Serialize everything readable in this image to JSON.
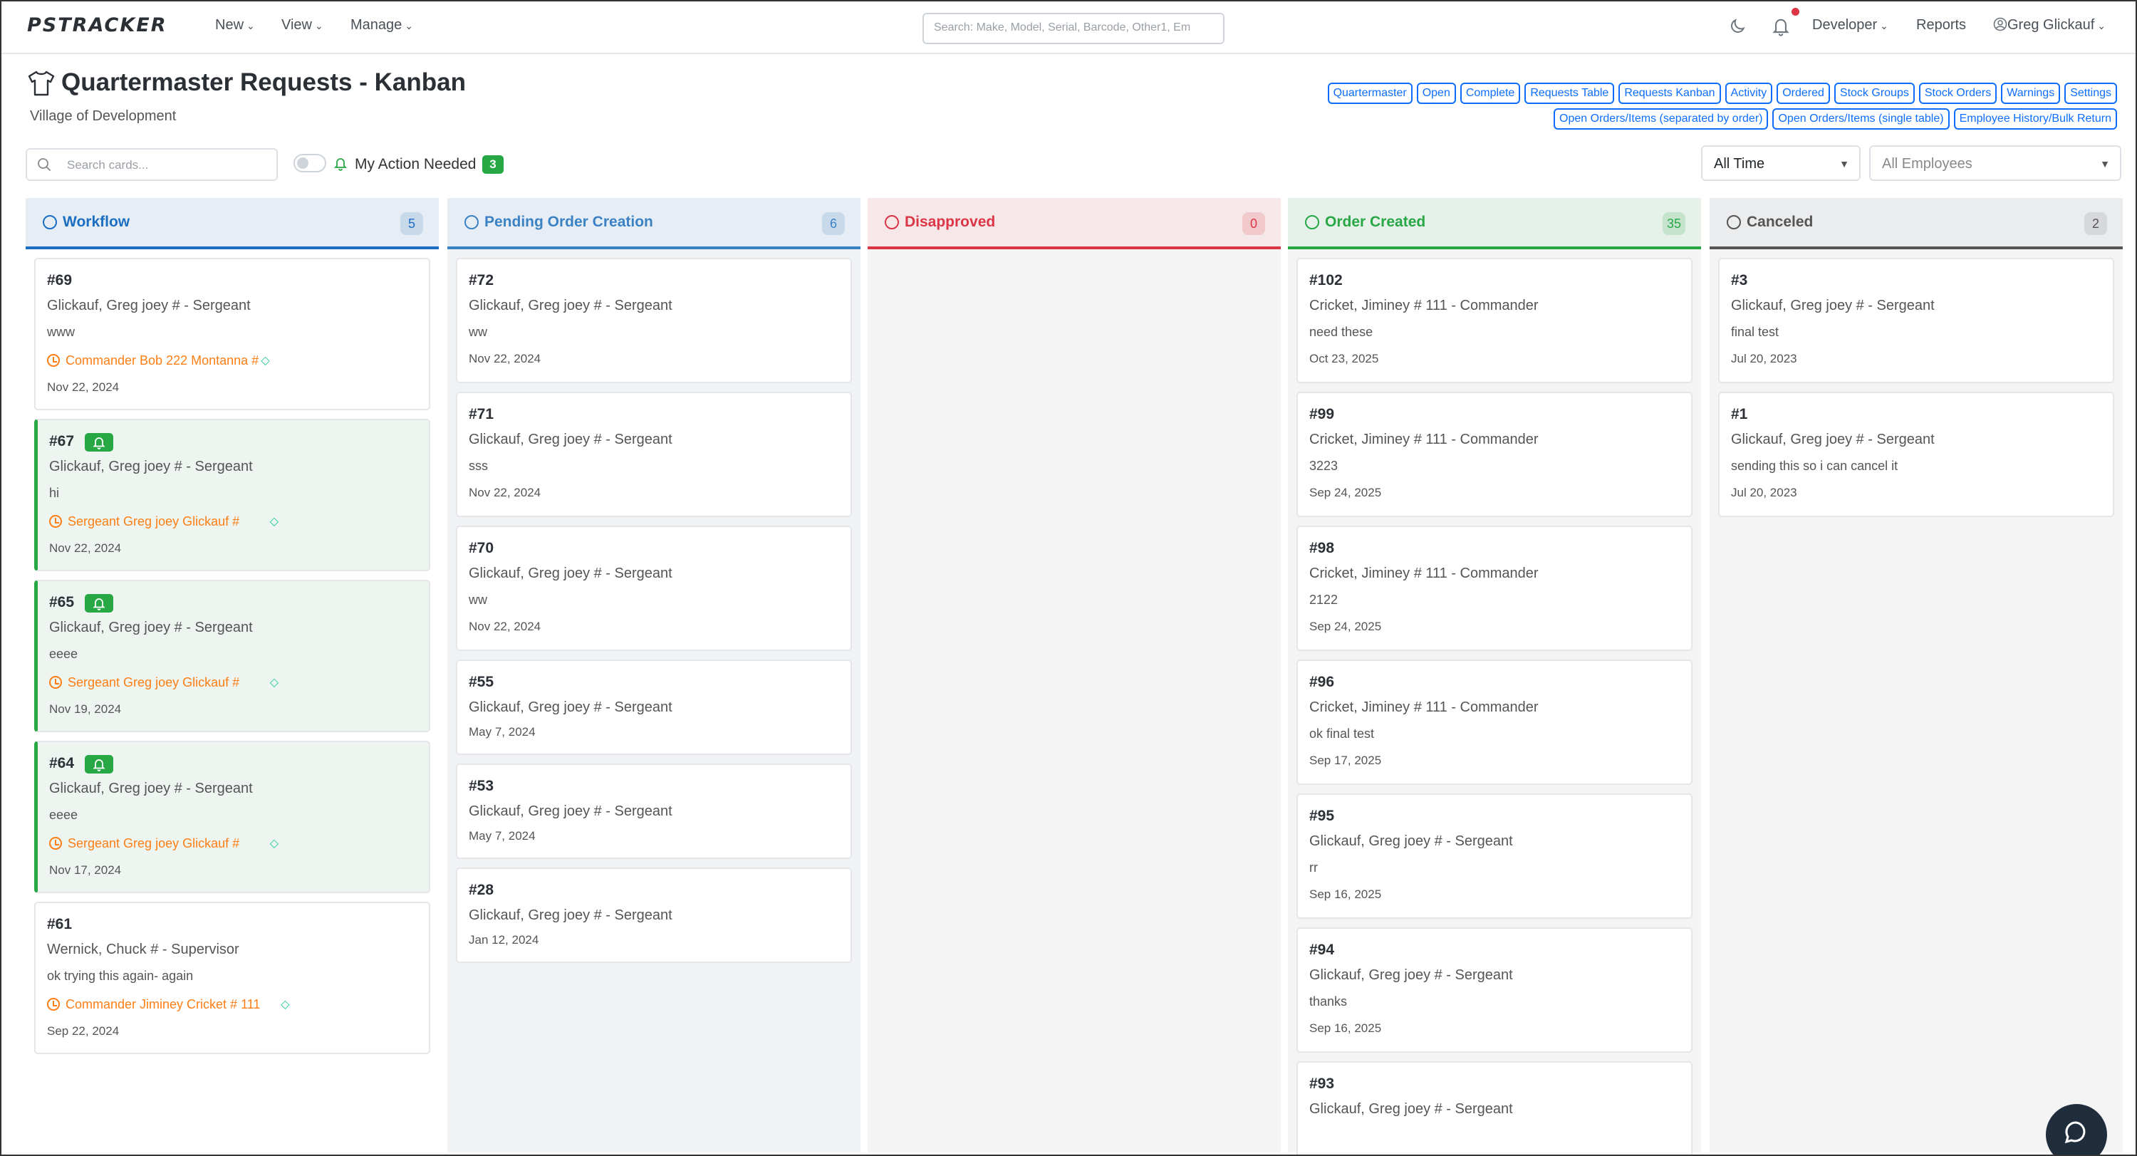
{
  "nav": {
    "brand": "PSTRACKER",
    "menus": [
      "New",
      "View",
      "Manage"
    ],
    "search_placeholder": "Search: Make, Model, Serial, Barcode, Other1, Em",
    "developer": "Developer",
    "reports": "Reports",
    "user": "Greg Glickauf"
  },
  "header": {
    "title": "Quartermaster Requests - Kanban",
    "subtitle": "Village of Development",
    "links": [
      "Quartermaster",
      "Open",
      "Complete",
      "Requests Table",
      "Requests Kanban",
      "Activity",
      "Ordered",
      "Stock Groups",
      "Stock Orders",
      "Warnings",
      "Settings",
      "Open Orders/Items (separated by order)",
      "Open Orders/Items (single table)",
      "Employee History/Bulk Return"
    ]
  },
  "toolbar": {
    "search_placeholder": "Search cards...",
    "action_label": "My Action Needed",
    "action_count": "3",
    "time_filter": "All Time",
    "employee_filter": "All Employees"
  },
  "colors": {
    "workflow": "#1b6ec2",
    "pending": "#3b82c4",
    "disapproved": "#dc3545",
    "order_created": "#28a745",
    "canceled": "#555555",
    "assignee": "#fd7e14"
  },
  "columns": [
    {
      "name": "Workflow",
      "count": "5",
      "cards": [
        {
          "id": "#69",
          "who": "Glickauf, Greg joey # - Sergeant",
          "note": "www",
          "assign": "Commander Bob 222 Montanna #",
          "date": "Nov 22, 2024",
          "action": false
        },
        {
          "id": "#67",
          "who": "Glickauf, Greg joey # - Sergeant",
          "note": "hi",
          "assign": "Sergeant Greg joey Glickauf #",
          "date": "Nov 22, 2024",
          "action": true
        },
        {
          "id": "#65",
          "who": "Glickauf, Greg joey # - Sergeant",
          "note": "eeee",
          "assign": "Sergeant Greg joey Glickauf #",
          "date": "Nov 19, 2024",
          "action": true
        },
        {
          "id": "#64",
          "who": "Glickauf, Greg joey # - Sergeant",
          "note": "eeee",
          "assign": "Sergeant Greg joey Glickauf #",
          "date": "Nov 17, 2024",
          "action": true
        },
        {
          "id": "#61",
          "who": "Wernick, Chuck # - Supervisor",
          "note": "ok trying this again- again",
          "assign": "Commander Jiminey Cricket # 111",
          "date": "Sep 22, 2024",
          "action": false
        }
      ]
    },
    {
      "name": "Pending Order Creation",
      "count": "6",
      "cards": [
        {
          "id": "#72",
          "who": "Glickauf, Greg joey # - Sergeant",
          "note": "ww",
          "date": "Nov 22, 2024"
        },
        {
          "id": "#71",
          "who": "Glickauf, Greg joey # - Sergeant",
          "note": "sss",
          "date": "Nov 22, 2024"
        },
        {
          "id": "#70",
          "who": "Glickauf, Greg joey # - Sergeant",
          "note": "ww",
          "date": "Nov 22, 2024"
        },
        {
          "id": "#55",
          "who": "Glickauf, Greg joey # - Sergeant",
          "note": "",
          "date": "May 7, 2024"
        },
        {
          "id": "#53",
          "who": "Glickauf, Greg joey # - Sergeant",
          "note": "",
          "date": "May 7, 2024"
        },
        {
          "id": "#28",
          "who": "Glickauf, Greg joey # - Sergeant",
          "note": "",
          "date": "Jan 12, 2024"
        }
      ]
    },
    {
      "name": "Disapproved",
      "count": "0",
      "cards": []
    },
    {
      "name": "Order Created",
      "count": "35",
      "cards": [
        {
          "id": "#102",
          "who": "Cricket, Jiminey # 111 - Commander",
          "note": "need these",
          "date": "Oct 23, 2025"
        },
        {
          "id": "#99",
          "who": "Cricket, Jiminey # 111 - Commander",
          "note": "3223",
          "date": "Sep 24, 2025"
        },
        {
          "id": "#98",
          "who": "Cricket, Jiminey # 111 - Commander",
          "note": "2122",
          "date": "Sep 24, 2025"
        },
        {
          "id": "#96",
          "who": "Cricket, Jiminey # 111 - Commander",
          "note": "ok final test",
          "date": "Sep 17, 2025"
        },
        {
          "id": "#95",
          "who": "Glickauf, Greg joey # - Sergeant",
          "note": "rr",
          "date": "Sep 16, 2025"
        },
        {
          "id": "#94",
          "who": "Glickauf, Greg joey # - Sergeant",
          "note": "thanks",
          "date": "Sep 16, 2025"
        },
        {
          "id": "#93",
          "who": "Glickauf, Greg joey # - Sergeant",
          "note": "",
          "date": ""
        }
      ]
    },
    {
      "name": "Canceled",
      "count": "2",
      "cards": [
        {
          "id": "#3",
          "who": "Glickauf, Greg joey # - Sergeant",
          "note": "final test",
          "date": "Jul 20, 2023"
        },
        {
          "id": "#1",
          "who": "Glickauf, Greg joey # - Sergeant",
          "note": "sending this so i can cancel it",
          "date": "Jul 20, 2023"
        }
      ]
    }
  ]
}
